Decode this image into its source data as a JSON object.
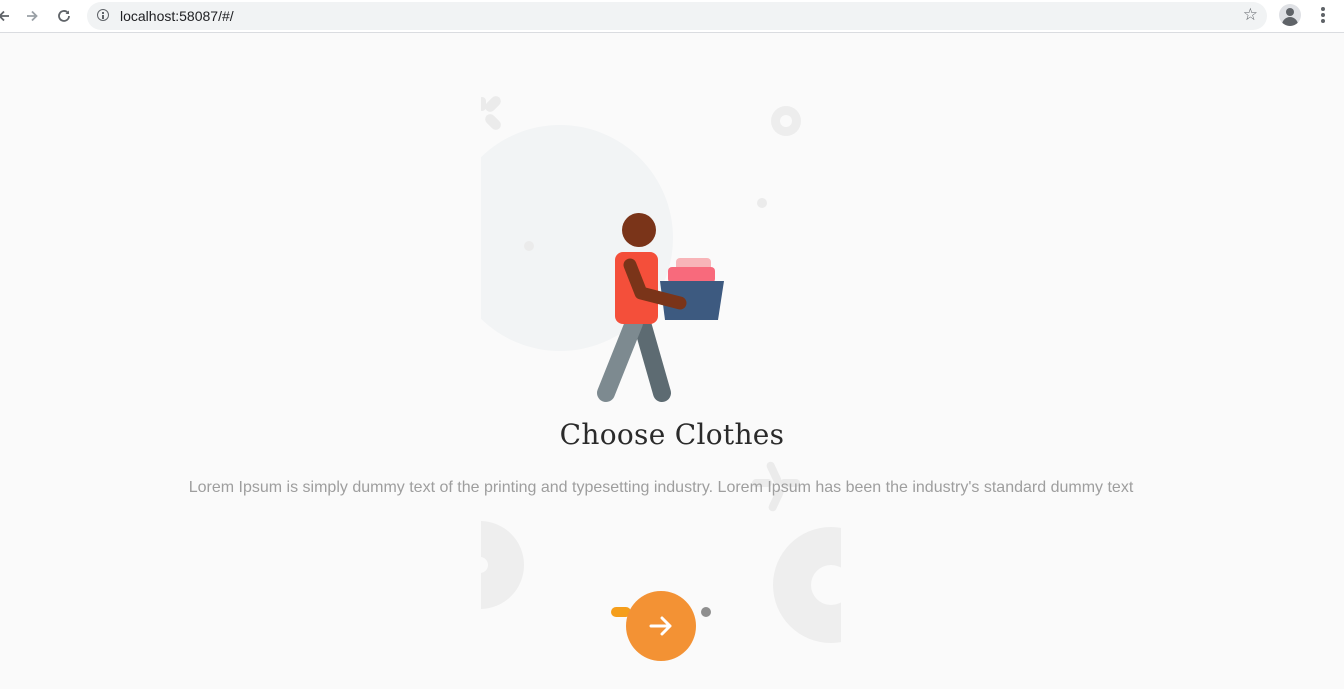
{
  "browser": {
    "url": "localhost:58087/#/",
    "back_icon": "arrow-left-icon",
    "forward_icon": "arrow-right-icon",
    "reload_icon": "reload-icon",
    "info_icon": "info-icon",
    "bookmark_icon": "star-icon",
    "profile_icon": "account-icon",
    "menu_icon": "more-vert-icon"
  },
  "onboarding": {
    "title": "Choose Clothes",
    "description": "Lorem Ipsum is simply dummy text of the printing and typesetting industry. Lorem Ipsum has been the industry's standard dummy text",
    "pagination": {
      "total": 2,
      "active": 1
    },
    "next_icon": "arrow-right-icon"
  },
  "colors": {
    "accent": "#f39234",
    "active_dot": "#f59e1b",
    "inactive_dot": "#8f8f8f",
    "background": "#fafafa",
    "shirt": "#f44f3a",
    "skin": "#7a3419",
    "basket": "#3d5a80",
    "pants": "#6b7b82"
  }
}
